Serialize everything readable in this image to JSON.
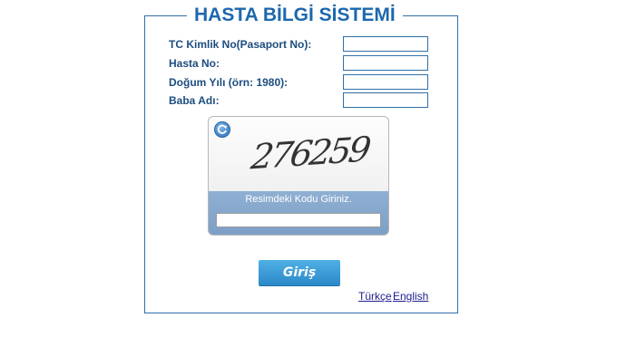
{
  "title": "HASTA BİLGİ SİSTEMİ",
  "form": {
    "fields": [
      {
        "label": "TC Kimlik No(Pasaport No):",
        "value": ""
      },
      {
        "label": "Hasta No:",
        "value": ""
      },
      {
        "label": "Doğum Yılı (örn: 1980):",
        "value": ""
      },
      {
        "label": "Baba Adı:",
        "value": ""
      }
    ]
  },
  "captcha": {
    "code": "276259",
    "hint": "Resimdeki Kodu Giriniz.",
    "refresh_icon": "refresh-icon",
    "value": ""
  },
  "login": {
    "label": "Giriş"
  },
  "languages": [
    {
      "label": "Türkçe"
    },
    {
      "label": "English"
    }
  ],
  "colors": {
    "accent": "#1d68ad",
    "border": "#2f6fa7",
    "button": "#2b89c8"
  }
}
